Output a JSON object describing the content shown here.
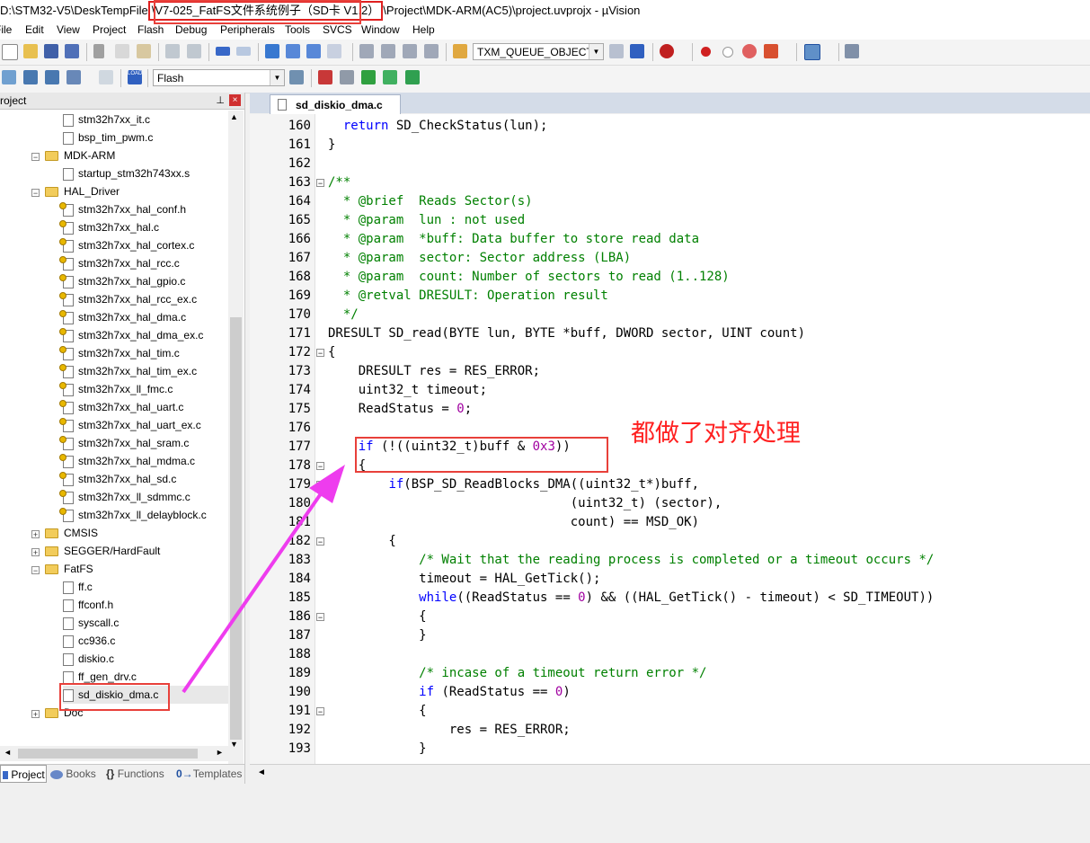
{
  "window": {
    "title_prefix": "D:\\STM32-V5\\DeskTempFile",
    "title_highlight": "\\V7-025_FatFS文件系统例子（SD卡 V1.2）",
    "title_suffix": "\\Project\\MDK-ARM(AC5)\\project.uvprojx - µVision"
  },
  "menu": [
    "File",
    "Edit",
    "View",
    "Project",
    "Flash",
    "Debug",
    "Peripherals",
    "Tools",
    "SVCS",
    "Window",
    "Help"
  ],
  "toolbar": {
    "find_combo": "TXM_QUEUE_OBJECT",
    "target_combo": "Flash",
    "load_label": "LOAD"
  },
  "project_panel": {
    "title": "Project",
    "pin_glyph": "⊥",
    "close_glyph": "×"
  },
  "tree": [
    {
      "label": "stm32h7xx_it.c"
    },
    {
      "label": "bsp_tim_pwm.c"
    },
    {
      "label": "MDK-ARM"
    },
    {
      "label": "startup_stm32h743xx.s"
    },
    {
      "label": "HAL_Driver"
    },
    {
      "label": "stm32h7xx_hal_conf.h"
    },
    {
      "label": "stm32h7xx_hal.c"
    },
    {
      "label": "stm32h7xx_hal_cortex.c"
    },
    {
      "label": "stm32h7xx_hal_rcc.c"
    },
    {
      "label": "stm32h7xx_hal_gpio.c"
    },
    {
      "label": "stm32h7xx_hal_rcc_ex.c"
    },
    {
      "label": "stm32h7xx_hal_dma.c"
    },
    {
      "label": "stm32h7xx_hal_dma_ex.c"
    },
    {
      "label": "stm32h7xx_hal_tim.c"
    },
    {
      "label": "stm32h7xx_hal_tim_ex.c"
    },
    {
      "label": "stm32h7xx_ll_fmc.c"
    },
    {
      "label": "stm32h7xx_hal_uart.c"
    },
    {
      "label": "stm32h7xx_hal_uart_ex.c"
    },
    {
      "label": "stm32h7xx_hal_sram.c"
    },
    {
      "label": "stm32h7xx_hal_mdma.c"
    },
    {
      "label": "stm32h7xx_hal_sd.c"
    },
    {
      "label": "stm32h7xx_ll_sdmmc.c"
    },
    {
      "label": "stm32h7xx_ll_delayblock.c"
    },
    {
      "label": "CMSIS"
    },
    {
      "label": "SEGGER/HardFault"
    },
    {
      "label": "FatFS"
    },
    {
      "label": "ff.c"
    },
    {
      "label": "ffconf.h"
    },
    {
      "label": "syscall.c"
    },
    {
      "label": "cc936.c"
    },
    {
      "label": "diskio.c"
    },
    {
      "label": "ff_gen_drv.c"
    },
    {
      "label": "sd_diskio_dma.c"
    },
    {
      "label": "Doc"
    }
  ],
  "bottom_tabs": [
    "Project",
    "Books",
    "Functions",
    "Templates"
  ],
  "bottom_tab_glyphs": {
    "functions": "{}",
    "templates": "0→"
  },
  "editor_tab": "sd_diskio_dma.c",
  "code_lines": [
    {
      "n": "160",
      "text": "  return SD_CheckStatus(lun);"
    },
    {
      "n": "161",
      "text": "}"
    },
    {
      "n": "162",
      "text": ""
    },
    {
      "n": "163",
      "text": "/**"
    },
    {
      "n": "164",
      "text": "  * @brief  Reads Sector(s)"
    },
    {
      "n": "165",
      "text": "  * @param  lun : not used"
    },
    {
      "n": "166",
      "text": "  * @param  *buff: Data buffer to store read data"
    },
    {
      "n": "167",
      "text": "  * @param  sector: Sector address (LBA)"
    },
    {
      "n": "168",
      "text": "  * @param  count: Number of sectors to read (1..128)"
    },
    {
      "n": "169",
      "text": "  * @retval DRESULT: Operation result"
    },
    {
      "n": "170",
      "text": "  */"
    },
    {
      "n": "171",
      "text": "DRESULT SD_read(BYTE lun, BYTE *buff, DWORD sector, UINT count)"
    },
    {
      "n": "172",
      "text": "{"
    },
    {
      "n": "173",
      "text": "    DRESULT res = RES_ERROR;"
    },
    {
      "n": "174",
      "text": "    uint32_t timeout;"
    },
    {
      "n": "175",
      "text": "    ReadStatus = 0;"
    },
    {
      "n": "176",
      "text": ""
    },
    {
      "n": "177",
      "text": "    if (!((uint32_t)buff & 0x3))"
    },
    {
      "n": "178",
      "text": "    {"
    },
    {
      "n": "179",
      "text": "        if(BSP_SD_ReadBlocks_DMA((uint32_t*)buff,"
    },
    {
      "n": "180",
      "text": "                                (uint32_t) (sector),"
    },
    {
      "n": "181",
      "text": "                                count) == MSD_OK)"
    },
    {
      "n": "182",
      "text": "        {"
    },
    {
      "n": "183",
      "text": "            /* Wait that the reading process is completed or a timeout occurs */"
    },
    {
      "n": "184",
      "text": "            timeout = HAL_GetTick();"
    },
    {
      "n": "185",
      "text": "            while((ReadStatus == 0) && ((HAL_GetTick() - timeout) < SD_TIMEOUT))"
    },
    {
      "n": "186",
      "text": "            {"
    },
    {
      "n": "187",
      "text": "            }"
    },
    {
      "n": "188",
      "text": ""
    },
    {
      "n": "189",
      "text": "            /* incase of a timeout return error */"
    },
    {
      "n": "190",
      "text": "            if (ReadStatus == 0)"
    },
    {
      "n": "191",
      "text": "            {"
    },
    {
      "n": "192",
      "text": "                res = RES_ERROR;"
    },
    {
      "n": "193",
      "text": "            }"
    }
  ],
  "annotation_text": "都做了对齐处理",
  "colors": {
    "highlight_box": "#e8403a",
    "arrow": "#ee3cee",
    "annotation": "#ff2020",
    "keyword": "#0000ff",
    "comment": "#008000",
    "number": "#a000a0"
  }
}
